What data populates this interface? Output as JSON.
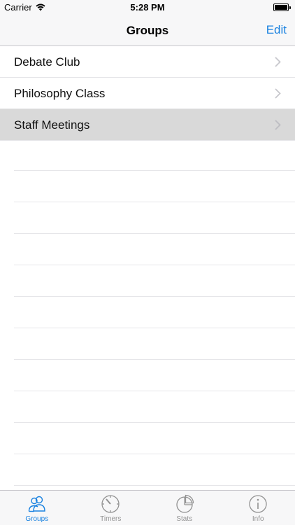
{
  "status_bar": {
    "carrier": "Carrier",
    "time": "5:28 PM"
  },
  "nav": {
    "title": "Groups",
    "edit_label": "Edit"
  },
  "groups": [
    {
      "label": "Debate Club"
    },
    {
      "label": "Philosophy Class"
    },
    {
      "label": "Staff Meetings"
    }
  ],
  "tabs": [
    {
      "label": "Groups",
      "icon": "groups-icon",
      "active": true
    },
    {
      "label": "Timers",
      "icon": "timer-icon",
      "active": false
    },
    {
      "label": "Stats",
      "icon": "pie-chart-icon",
      "active": false
    },
    {
      "label": "Info",
      "icon": "info-icon",
      "active": false
    }
  ],
  "colors": {
    "accent": "#1a82e0",
    "selected_row": "#d9d9d9",
    "inactive_tab": "#929292"
  }
}
